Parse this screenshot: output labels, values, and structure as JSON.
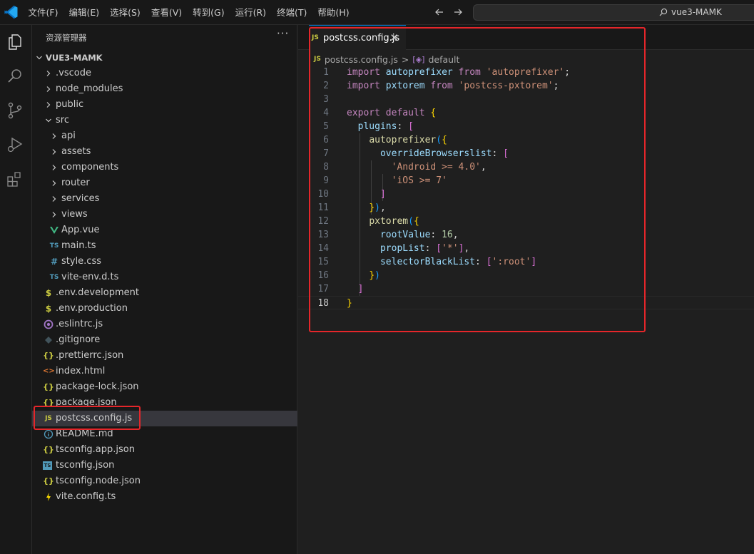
{
  "titlebar": {
    "menu": [
      "文件(F)",
      "编辑(E)",
      "选择(S)",
      "查看(V)",
      "转到(G)",
      "运行(R)",
      "终端(T)",
      "帮助(H)"
    ],
    "search_text": "vue3-MAMK"
  },
  "sidebar": {
    "title": "资源管理器",
    "more": "···",
    "root": "VUE3-MAMK",
    "items": [
      {
        "label": ".vscode",
        "icon": "chevron-right-icon"
      },
      {
        "label": "node_modules",
        "icon": "chevron-right-icon"
      },
      {
        "label": "public",
        "icon": "chevron-right-icon"
      },
      {
        "label": "src",
        "icon": "chevron-down-icon"
      },
      {
        "label": "api",
        "icon": "chevron-right-icon"
      },
      {
        "label": "assets",
        "icon": "chevron-right-icon"
      },
      {
        "label": "components",
        "icon": "chevron-right-icon"
      },
      {
        "label": "router",
        "icon": "chevron-right-icon"
      },
      {
        "label": "services",
        "icon": "chevron-right-icon"
      },
      {
        "label": "views",
        "icon": "chevron-right-icon"
      },
      {
        "label": "App.vue",
        "icon": "vue-file-icon"
      },
      {
        "label": "main.ts",
        "icon": "ts-file-icon",
        "badge": "TS"
      },
      {
        "label": "style.css",
        "icon": "css-file-icon",
        "badge": "#"
      },
      {
        "label": "vite-env.d.ts",
        "icon": "ts-file-icon",
        "badge": "TS"
      },
      {
        "label": ".env.development",
        "icon": "env-file-icon",
        "badge": "$"
      },
      {
        "label": ".env.production",
        "icon": "env-file-icon",
        "badge": "$"
      },
      {
        "label": ".eslintrc.js",
        "icon": "eslint-file-icon"
      },
      {
        "label": ".gitignore",
        "icon": "git-file-icon"
      },
      {
        "label": ".prettierrc.json",
        "icon": "json-file-icon",
        "badge": "{}"
      },
      {
        "label": "index.html",
        "icon": "html-file-icon",
        "badge": "<>"
      },
      {
        "label": "package-lock.json",
        "icon": "json-file-icon",
        "badge": "{}"
      },
      {
        "label": "package.json",
        "icon": "json-file-icon",
        "badge": "{}"
      },
      {
        "label": "postcss.config.js",
        "icon": "js-file-icon",
        "badge": "JS"
      },
      {
        "label": "README.md",
        "icon": "info-file-icon",
        "badge": "i"
      },
      {
        "label": "tsconfig.app.json",
        "icon": "json-file-icon",
        "badge": "{}"
      },
      {
        "label": "tsconfig.json",
        "icon": "tsconfig-file-icon",
        "badge": "TS"
      },
      {
        "label": "tsconfig.node.json",
        "icon": "json-file-icon",
        "badge": "{}"
      },
      {
        "label": "vite.config.ts",
        "icon": "vite-file-icon"
      }
    ]
  },
  "editor": {
    "tab_badge": "JS",
    "tab_label": "postcss.config.js",
    "tab_close": "✕",
    "breadcrumb": {
      "badge": "JS",
      "file": "postcss.config.js",
      "separator": ">",
      "symbol": "default"
    },
    "line_numbers": [
      "1",
      "2",
      "3",
      "4",
      "5",
      "6",
      "7",
      "8",
      "9",
      "10",
      "11",
      "12",
      "13",
      "14",
      "15",
      "16",
      "17",
      "18"
    ],
    "current_line": 18
  },
  "colors": {
    "highlight_box": "#e5262a",
    "accent": "#0078d4"
  }
}
